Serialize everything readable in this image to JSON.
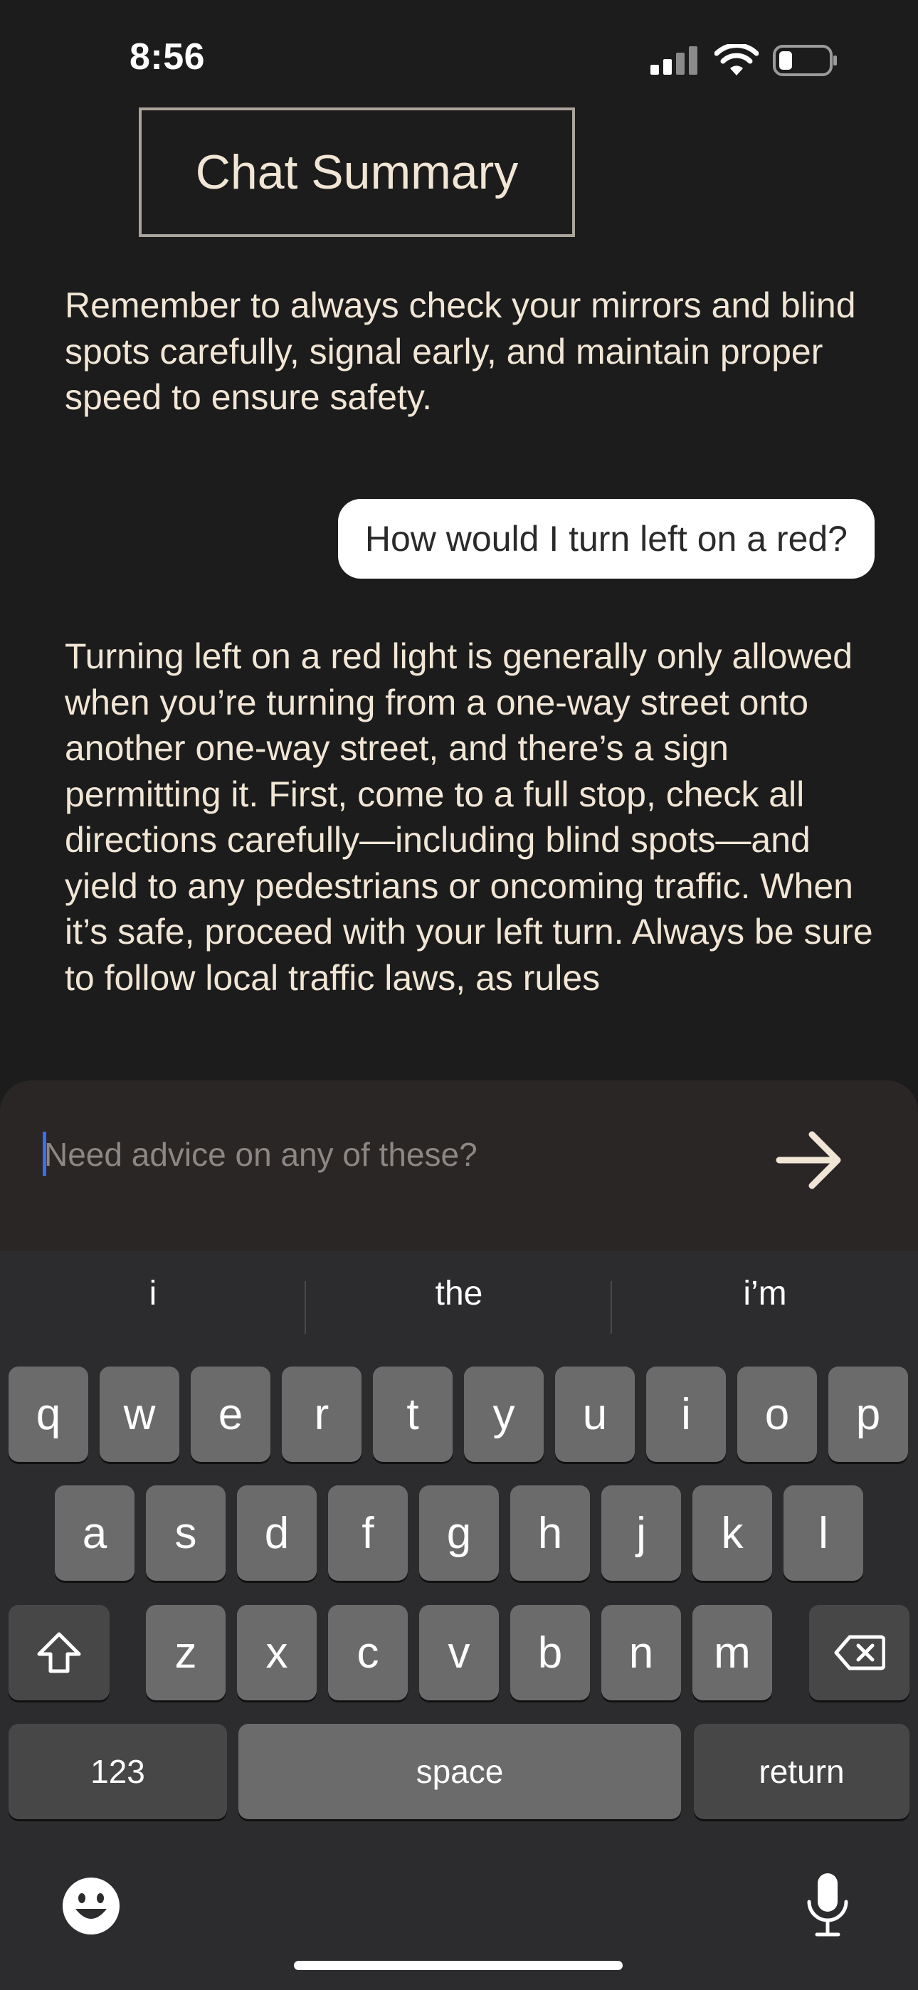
{
  "status_bar": {
    "time": "8:56"
  },
  "header": {
    "summary_button": "Chat Summary"
  },
  "messages": {
    "assistant_1": "Remember to always check your mirrors and blind spots carefully, signal early, and maintain proper speed to ensure safety.",
    "user_1": "How would I turn left on a red?",
    "assistant_2": "Turning left on a red light is generally only allowed when you’re turning from a one-way street onto another one-way street, and there’s a sign permitting it. First, come to a full stop, check all directions carefully—including blind spots—and yield to any pedestrians or oncoming traffic. When it’s safe, proceed with your left turn. Always be sure to follow local traffic laws, as rules"
  },
  "composer": {
    "placeholder": "Need advice on any of these?",
    "send_icon": "arrow-right-icon"
  },
  "keyboard": {
    "suggestions": [
      "i",
      "the",
      "i’m"
    ],
    "row1": [
      "q",
      "w",
      "e",
      "r",
      "t",
      "y",
      "u",
      "i",
      "o",
      "p"
    ],
    "row2": [
      "a",
      "s",
      "d",
      "f",
      "g",
      "h",
      "j",
      "k",
      "l"
    ],
    "row3": [
      "z",
      "x",
      "c",
      "v",
      "b",
      "n",
      "m"
    ],
    "numbers_key": "123",
    "space_key": "space",
    "return_key": "return",
    "shift_icon": "shift-icon",
    "delete_icon": "delete-icon",
    "emoji_icon": "emoji-icon",
    "mic_icon": "microphone-icon"
  },
  "colors": {
    "background": "#1c1c1c",
    "text_cream": "#f1e6d5",
    "composer_bg": "#2b2626",
    "keyboard_bg": "#2c2c2e",
    "key_bg": "#6b6b6b",
    "key_dark_bg": "#474747",
    "caret": "#3b6ef5"
  }
}
